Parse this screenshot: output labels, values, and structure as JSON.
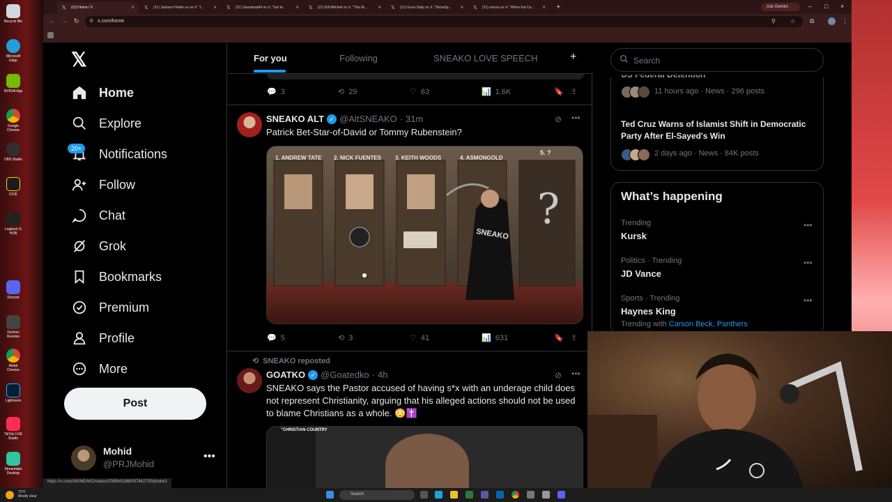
{
  "browser": {
    "tabs": [
      {
        "title": "(21) Home / X",
        "active": true
      },
      {
        "title": "(21) Jackson Hinkle us on X: \"I..."
      },
      {
        "title": "(21) Sassafras84 on X: \"Get le..."
      },
      {
        "title": "(21) Bill Mitchell on X: \"This M..."
      },
      {
        "title": "(21) Guns Daily on X: \"ShowSp..."
      },
      {
        "title": "(21) veizau on X: \"When Kai Ce..."
      }
    ],
    "ask_gemini": "Ask Gemini",
    "url": "x.com/home",
    "status_url": "https://x.com/AltSNEAKO/status/2085601868097462700/photo/1"
  },
  "nav": {
    "items": [
      {
        "label": "Home",
        "icon": "home-icon"
      },
      {
        "label": "Explore",
        "icon": "search-icon"
      },
      {
        "label": "Notifications",
        "icon": "bell-icon"
      },
      {
        "label": "Follow",
        "icon": "follow-icon"
      },
      {
        "label": "Chat",
        "icon": "chat-icon"
      },
      {
        "label": "Grok",
        "icon": "grok-icon"
      },
      {
        "label": "Bookmarks",
        "icon": "bookmark-icon"
      },
      {
        "label": "Premium",
        "icon": "premium-icon"
      },
      {
        "label": "Profile",
        "icon": "profile-icon"
      },
      {
        "label": "More",
        "icon": "more-icon"
      }
    ],
    "notifications_badge": "20+",
    "post_label": "Post",
    "account": {
      "name": "Mohid",
      "handle": "@PRJMohid"
    }
  },
  "feed": {
    "tabs": [
      "For you",
      "Following",
      "SNEAKO LOVE SPEECH"
    ],
    "top_actions": {
      "replies": "3",
      "reposts": "29",
      "likes": "63",
      "views": "1.6K"
    },
    "tweet1": {
      "name": "SNEAKO ALT",
      "handle": "@AltSNEAKO",
      "time": "31m",
      "text": "Patrick Bet-Star-of-David or Tommy Rubenstein?",
      "image_labels": [
        "1. ANDREW TATE",
        "2. NICK FUENTES",
        "3. KEITH WOODS",
        "4. ASMONGOLD",
        "5. ?"
      ],
      "image_sign": "SNEAKO",
      "actions": {
        "replies": "5",
        "reposts": "3",
        "likes": "41",
        "views": "631"
      }
    },
    "tweet2": {
      "repost_by": "SNEAKO reposted",
      "name": "GOATKO",
      "handle": "@Goatedko",
      "time": "4h",
      "text": "SNEAKO says the Pastor accused of having s*x with an underage child does not represent Christianity, arguing that his alleged actions should not be used to blame Christians as a whole. 😳✝️",
      "media_caption": "\"CHRISTIAN COUNTRY"
    }
  },
  "sidebar": {
    "search_placeholder": "Search",
    "news": [
      {
        "title": "US Federal Detention",
        "meta": "11 hours ago · News · 296 posts"
      },
      {
        "title": "Ted Cruz Warns of Islamist Shift in Democratic Party After El-Sayed's Win",
        "meta": "2 days ago · News · 84K posts"
      }
    ],
    "whats_happening": "What’s happening",
    "trends": [
      {
        "context": "Trending",
        "name": "Kursk"
      },
      {
        "context": "Politics · Trending",
        "name": "JD Vance"
      },
      {
        "context": "Sports · Trending",
        "name": "Haynes King",
        "with_label": "Trending with",
        "with": "Carson Beck, Panthers"
      }
    ]
  },
  "desktop_icons": [
    "Recycle Bin",
    "Microsoft Edge",
    "NVIDIA App",
    "Google Chrome",
    "OBS Studio",
    "iCUE",
    "Logitech G HUB",
    "Discord",
    "DaVinci Resolve",
    "Abdul Chrome",
    "Lightroom",
    "TikTok LIVE Studio",
    "Streamlabs Desktop"
  ],
  "taskbar": {
    "search": "Search",
    "weather": "72°F",
    "weather_desc": "Mostly clear"
  },
  "colors": {
    "accent": "#1d9bf0",
    "bg": "#000000",
    "border": "#2f3336",
    "muted": "#71767b"
  }
}
